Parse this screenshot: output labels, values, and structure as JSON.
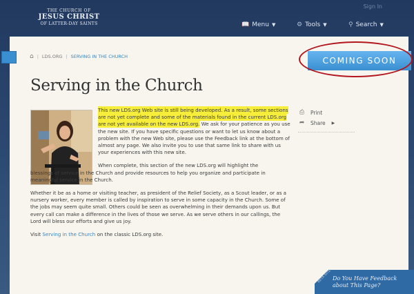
{
  "header": {
    "logo": {
      "line1": "THE CHURCH OF",
      "line2": "JESUS CHRIST",
      "line3": "OF LATTER-DAY SAINTS"
    },
    "sign_in": "Sign In",
    "nav": [
      {
        "label": "Menu",
        "icon": "book-icon"
      },
      {
        "label": "Tools",
        "icon": "gear-icon"
      },
      {
        "label": "Search",
        "icon": "search-icon"
      }
    ]
  },
  "breadcrumb": {
    "home_icon": "home-icon",
    "items": [
      "LDS.ORG",
      "SERVING IN THE CHURCH"
    ]
  },
  "banner": {
    "label": "COMING SOON",
    "color": "#3a8fd0"
  },
  "page_title": "Serving in the Church",
  "content": {
    "intro_highlight": "This new LDS.org Web site is still being developed. As a result, some sections are not yet complete and some of the materials found in the current LDS.org are not yet available on the new LDS.org.",
    "intro_rest": " We ask for your patience as you use the new site. If you have specific questions or want to let us know about a problem with the new Web site, please use the Feedback link at the bottom of almost any page. We also invite you to use that same link to share with us your experiences with this new site.",
    "para2_start": "When complete, this section of the new LDS.org will highlight the",
    "para2_rest": "blessings of service in the Church and provide resources to help you organize and participate in meaningful service in the Church.",
    "para3": "Whether it be as a home or visiting teacher, as president of the Relief Society, as a Scout leader, or as a nursery worker, every member is called by inspiration to serve in some capacity in the Church. Some of the jobs may seem quite small. Others could be seen as overwhelming in their demands upon us. But every call can make a difference in the lives of those we serve. As we serve others in our callings, the Lord will bless our efforts and give us joy.",
    "visit_prefix": "Visit ",
    "visit_link": "Serving in the Church",
    "visit_suffix": " on the classic LDS.org site."
  },
  "sidebar": {
    "print_label": "Print",
    "share_label": "Share"
  },
  "feedback": {
    "tag": "BETA SITE",
    "line1": "Do You Have Feedback",
    "line2": "about This Page?"
  }
}
